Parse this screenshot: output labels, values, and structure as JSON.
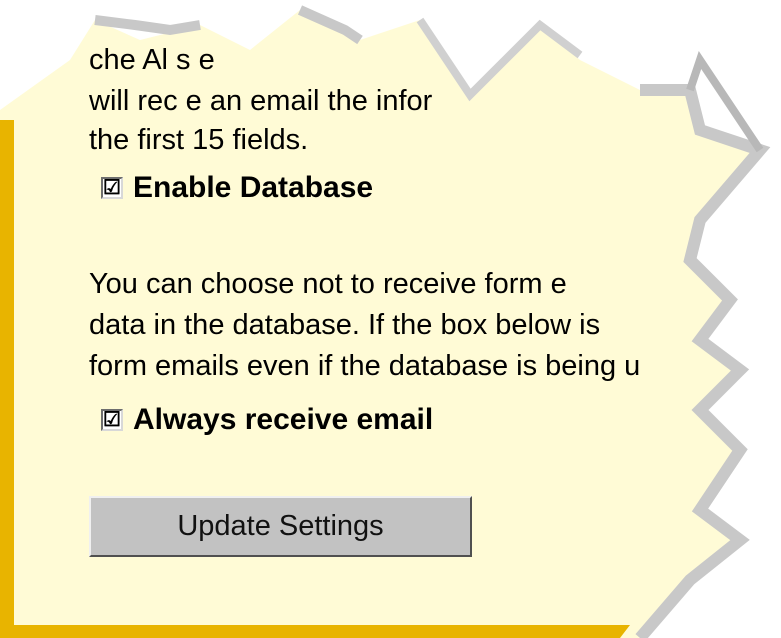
{
  "text": {
    "line1": "che        Al         s e",
    "line2": "will rec  e an email     the infor",
    "line3": "the first 15 fields.",
    "paragraph2": [
      "You can choose not to receive form e",
      "data in the database. If the box below is",
      "form emails even if the database is being u"
    ]
  },
  "options": {
    "enable_database": {
      "label": "Enable Database",
      "checked": true,
      "mark": "☑"
    },
    "always_email": {
      "label": "Always receive email",
      "checked": true,
      "mark": "☑"
    }
  },
  "buttons": {
    "update": "Update Settings"
  },
  "colors": {
    "panel": "#fffbd6",
    "border_accent": "#e8b400",
    "torn_edge": "#c8c8c8"
  }
}
